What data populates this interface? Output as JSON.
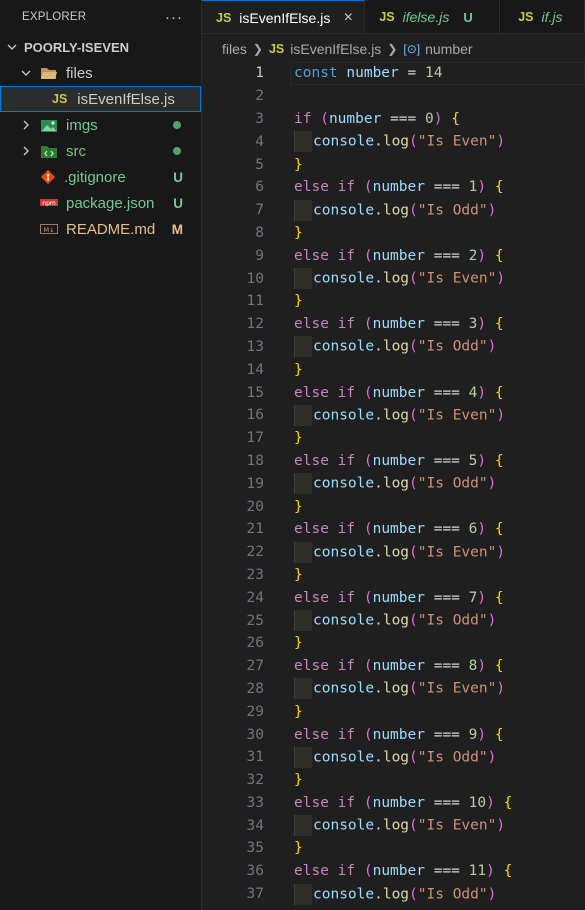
{
  "explorer": {
    "title": "EXPLORER",
    "more": "···",
    "project": "POORLY-ISEVEN",
    "items": [
      {
        "label": "files",
        "type": "folder-open",
        "badge": ""
      },
      {
        "label": "isEvenIfElse.js",
        "type": "js",
        "badge": ""
      },
      {
        "label": "imgs",
        "type": "folder",
        "badge": "dot"
      },
      {
        "label": "src",
        "type": "folder",
        "badge": "dot"
      },
      {
        "label": ".gitignore",
        "type": "git",
        "badge": "U"
      },
      {
        "label": "package.json",
        "type": "npm",
        "badge": "U"
      },
      {
        "label": "README.md",
        "type": "md",
        "badge": "M"
      }
    ]
  },
  "tabs": [
    {
      "icon": "JS",
      "label": "isEvenIfElse.js",
      "close": "×"
    },
    {
      "icon": "JS",
      "label": "ifelse.js",
      "status": "U"
    },
    {
      "icon": "JS",
      "label": "if.js"
    }
  ],
  "breadcrumb": {
    "folder": "files",
    "file": "isEvenIfElse.js",
    "symbol": "number"
  },
  "code": {
    "first_line": "const number = 14",
    "cases": [
      0,
      1,
      2,
      3,
      4,
      5,
      6,
      7,
      8,
      9,
      10,
      11
    ],
    "even": "\"Is Even\"",
    "odd": "\"Is Odd\""
  },
  "colors": {
    "accent": "#0078d4",
    "untracked": "#73c991",
    "modified": "#e2c08d",
    "js": "#cbcb41"
  }
}
